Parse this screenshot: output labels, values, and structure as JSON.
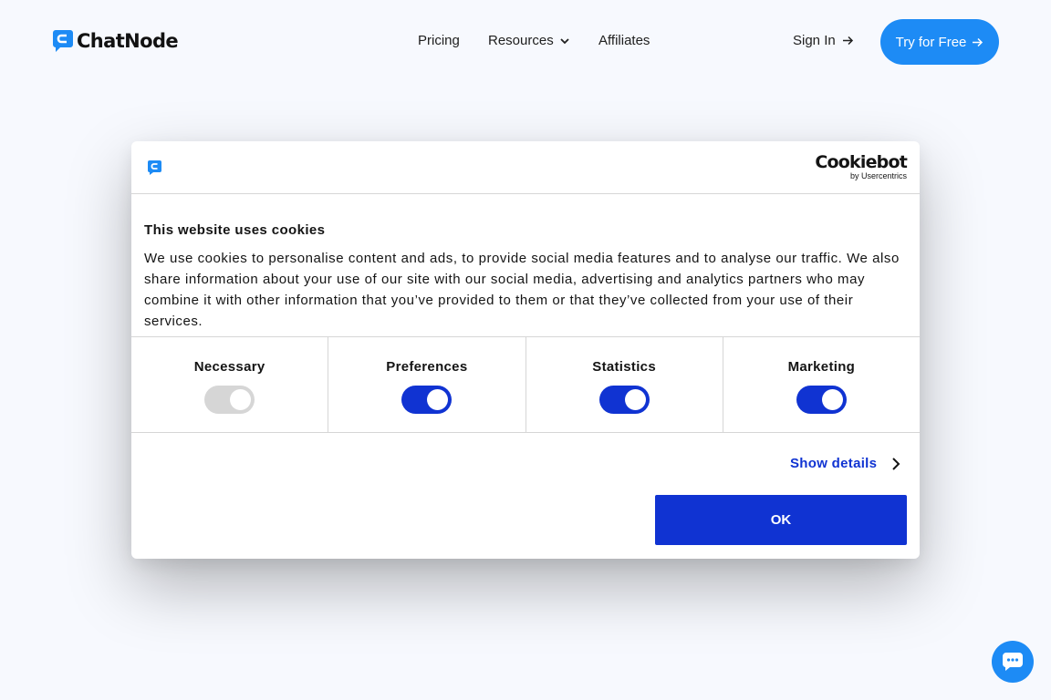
{
  "header": {
    "logo_text": "ChatNode",
    "nav": {
      "pricing": "Pricing",
      "resources": "Resources",
      "affiliates": "Affiliates"
    },
    "sign_in": "Sign In",
    "cta": "Try for Free"
  },
  "cookie_dialog": {
    "brand": "Cookiebot",
    "brand_by": "by Usercentrics",
    "title": "This website uses cookies",
    "text": "We use cookies to personalise content and ads, to provide social media features and to analyse our traffic. We also share information about your use of our site with our social media, advertising and analytics partners who may combine it with other information that you’ve provided to them or that they’ve collected from your use of their services.",
    "toggles": [
      {
        "label": "Necessary",
        "checked": true,
        "disabled": true
      },
      {
        "label": "Preferences",
        "checked": true,
        "disabled": false
      },
      {
        "label": "Statistics",
        "checked": true,
        "disabled": false
      },
      {
        "label": "Marketing",
        "checked": true,
        "disabled": false
      }
    ],
    "show_details": "Show details",
    "ok_label": "OK"
  },
  "colors": {
    "brand_blue": "#1d8bf5",
    "consent_blue": "#1033d2",
    "background": "#f7f9fe"
  },
  "icons": {
    "chat_launcher": "chat-bubble-icon"
  }
}
